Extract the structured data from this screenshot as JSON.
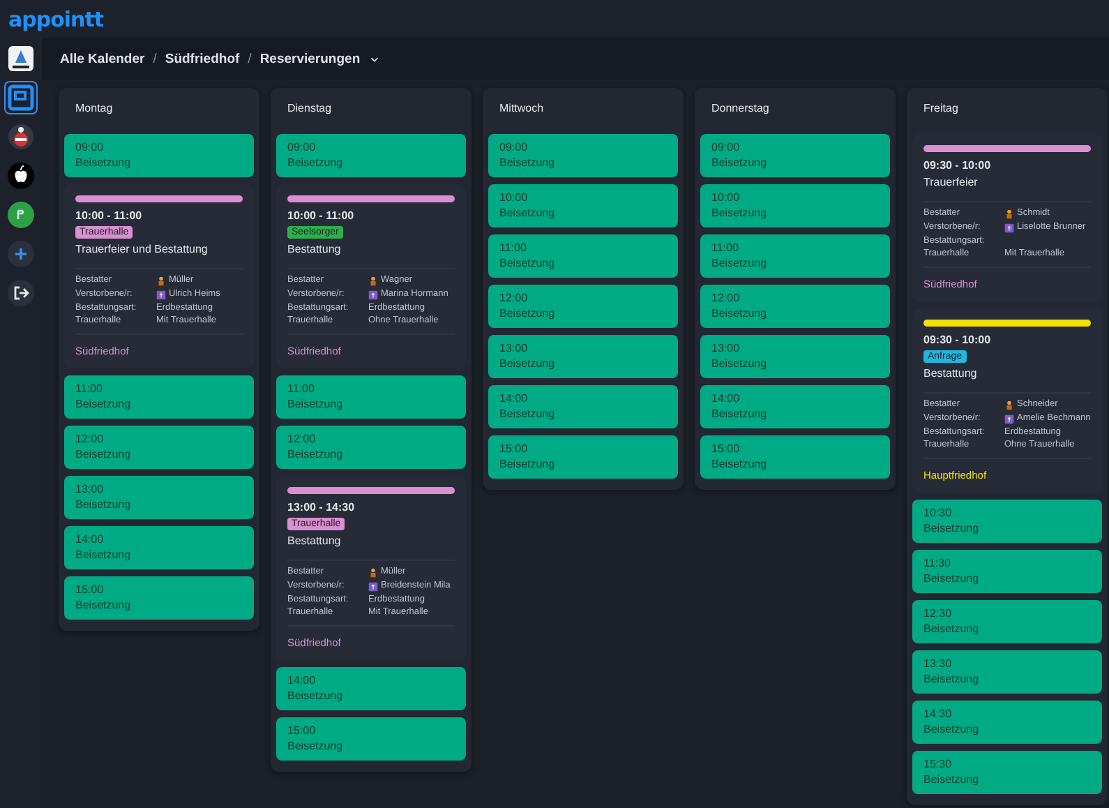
{
  "app": {
    "logo": "appointt"
  },
  "sidebar": {
    "items": [
      {
        "kind": "org",
        "selected": false
      },
      {
        "kind": "square",
        "selected": true
      },
      {
        "kind": "crest",
        "selected": false
      },
      {
        "kind": "apple",
        "selected": false
      },
      {
        "kind": "green",
        "selected": false
      },
      {
        "kind": "add",
        "selected": false
      },
      {
        "kind": "logout",
        "selected": false
      }
    ]
  },
  "breadcrumb": {
    "separator": "/",
    "items": [
      "Alle Kalender",
      "Südfriedhof",
      "Reservierungen"
    ]
  },
  "days": [
    {
      "name": "Montag",
      "slots": [
        {
          "kind": "free",
          "time": "09:00",
          "label": "Beisetzung"
        },
        {
          "kind": "booking",
          "color": "#d98fd0",
          "time": "10:00 - 11:00",
          "tag": {
            "text": "Trauerhalle",
            "color": "#d98fd0"
          },
          "title": "Trauerfeier und Bestattung",
          "details": [
            {
              "kind": "undertaker",
              "label": "Bestatter",
              "value": "Müller"
            },
            {
              "kind": "deceased",
              "label": "Verstorbene/r:",
              "value": "Ulrich Heims"
            },
            {
              "kind": "plain",
              "label": "Bestattungsart:",
              "value": "Erdbestattung"
            },
            {
              "kind": "plain",
              "label": "Trauerhalle",
              "value": "Mit Trauerhalle"
            }
          ],
          "location": "Südfriedhof"
        },
        {
          "kind": "free",
          "time": "11:00",
          "label": "Beisetzung"
        },
        {
          "kind": "free",
          "time": "12:00",
          "label": "Beisetzung"
        },
        {
          "kind": "free",
          "time": "13:00",
          "label": "Beisetzung"
        },
        {
          "kind": "free",
          "time": "14:00",
          "label": "Beisetzung"
        },
        {
          "kind": "free",
          "time": "15:00",
          "label": "Beisetzung"
        }
      ]
    },
    {
      "name": "Dienstag",
      "slots": [
        {
          "kind": "free",
          "time": "09:00",
          "label": "Beisetzung"
        },
        {
          "kind": "booking",
          "color": "#d98fd0",
          "time": "10:00 - 11:00",
          "tag": {
            "text": "Seelsorger",
            "color": "#2bb14a"
          },
          "title": "Bestattung",
          "details": [
            {
              "kind": "undertaker",
              "label": "Bestatter",
              "value": "Wagner"
            },
            {
              "kind": "deceased",
              "label": "Verstorbene/r:",
              "value": "Marina Hormann"
            },
            {
              "kind": "plain",
              "label": "Bestattungsart:",
              "value": "Erdbestattung"
            },
            {
              "kind": "plain",
              "label": "Trauerhalle",
              "value": "Ohne Trauerhalle"
            }
          ],
          "location": "Südfriedhof"
        },
        {
          "kind": "free",
          "time": "11:00",
          "label": "Beisetzung"
        },
        {
          "kind": "free",
          "time": "12:00",
          "label": "Beisetzung"
        },
        {
          "kind": "booking",
          "color": "#d98fd0",
          "time": "13:00 - 14:30",
          "tag": {
            "text": "Trauerhalle",
            "color": "#d98fd0"
          },
          "title": "Bestattung",
          "details": [
            {
              "kind": "undertaker",
              "label": "Bestatter",
              "value": "Müller"
            },
            {
              "kind": "deceased",
              "label": "Verstorbene/r:",
              "value": "Breidenstein Mila"
            },
            {
              "kind": "plain",
              "label": "Bestattungsart:",
              "value": "Erdbestattung"
            },
            {
              "kind": "plain",
              "label": "Trauerhalle",
              "value": "Mit Trauerhalle"
            }
          ],
          "location": "Südfriedhof"
        },
        {
          "kind": "free",
          "time": "14:00",
          "label": "Beisetzung"
        },
        {
          "kind": "free",
          "time": "15:00",
          "label": "Beisetzung"
        }
      ]
    },
    {
      "name": "Mittwoch",
      "slots": [
        {
          "kind": "free",
          "time": "09:00",
          "label": "Beisetzung"
        },
        {
          "kind": "free",
          "time": "10:00",
          "label": "Beisetzung"
        },
        {
          "kind": "free",
          "time": "11:00",
          "label": "Beisetzung"
        },
        {
          "kind": "free",
          "time": "12:00",
          "label": "Beisetzung"
        },
        {
          "kind": "free",
          "time": "13:00",
          "label": "Beisetzung"
        },
        {
          "kind": "free",
          "time": "14:00",
          "label": "Beisetzung"
        },
        {
          "kind": "free",
          "time": "15:00",
          "label": "Beisetzung"
        }
      ]
    },
    {
      "name": "Donnerstag",
      "slots": [
        {
          "kind": "free",
          "time": "09:00",
          "label": "Beisetzung"
        },
        {
          "kind": "free",
          "time": "10:00",
          "label": "Beisetzung"
        },
        {
          "kind": "free",
          "time": "11:00",
          "label": "Beisetzung"
        },
        {
          "kind": "free",
          "time": "12:00",
          "label": "Beisetzung"
        },
        {
          "kind": "free",
          "time": "13:00",
          "label": "Beisetzung"
        },
        {
          "kind": "free",
          "time": "14:00",
          "label": "Beisetzung"
        },
        {
          "kind": "free",
          "time": "15:00",
          "label": "Beisetzung"
        }
      ]
    },
    {
      "name": "Freitag",
      "slots": [
        {
          "kind": "booking",
          "color": "#d98fd0",
          "time": "09:30 - 10:00",
          "title": "Trauerfeier",
          "details": [
            {
              "kind": "undertaker",
              "label": "Bestatter",
              "value": "Schmidt"
            },
            {
              "kind": "deceased",
              "label": "Verstorbene/r:",
              "value": "Liselotte Brunner"
            },
            {
              "kind": "plain",
              "label": "Bestattungsart:"
            },
            {
              "kind": "plain",
              "label": "Trauerhalle",
              "value": "Mit Trauerhalle"
            }
          ],
          "location": "Südfriedhof"
        },
        {
          "kind": "booking",
          "color": "#f2e10a",
          "time": "09:30 - 10:00",
          "tag": {
            "text": "Anfrage",
            "color": "#1fb6e0"
          },
          "title": "Bestattung",
          "details": [
            {
              "kind": "undertaker",
              "label": "Bestatter",
              "value": "Schneider"
            },
            {
              "kind": "deceased",
              "label": "Verstorbene/r:",
              "value": "Amelie Bechmann"
            },
            {
              "kind": "plain",
              "label": "Bestattungsart:",
              "value": "Erdbestattung"
            },
            {
              "kind": "plain",
              "label": "Trauerhalle",
              "value": "Ohne Trauerhalle"
            }
          ],
          "location": "Hauptfriedhof"
        },
        {
          "kind": "free",
          "time": "10:30",
          "label": "Beisetzung"
        },
        {
          "kind": "free",
          "time": "11:30",
          "label": "Beisetzung"
        },
        {
          "kind": "free",
          "time": "12:30",
          "label": "Beisetzung"
        },
        {
          "kind": "free",
          "time": "13:30",
          "label": "Beisetzung"
        },
        {
          "kind": "free",
          "time": "14:30",
          "label": "Beisetzung"
        },
        {
          "kind": "free",
          "time": "15:30",
          "label": "Beisetzung"
        }
      ]
    }
  ]
}
